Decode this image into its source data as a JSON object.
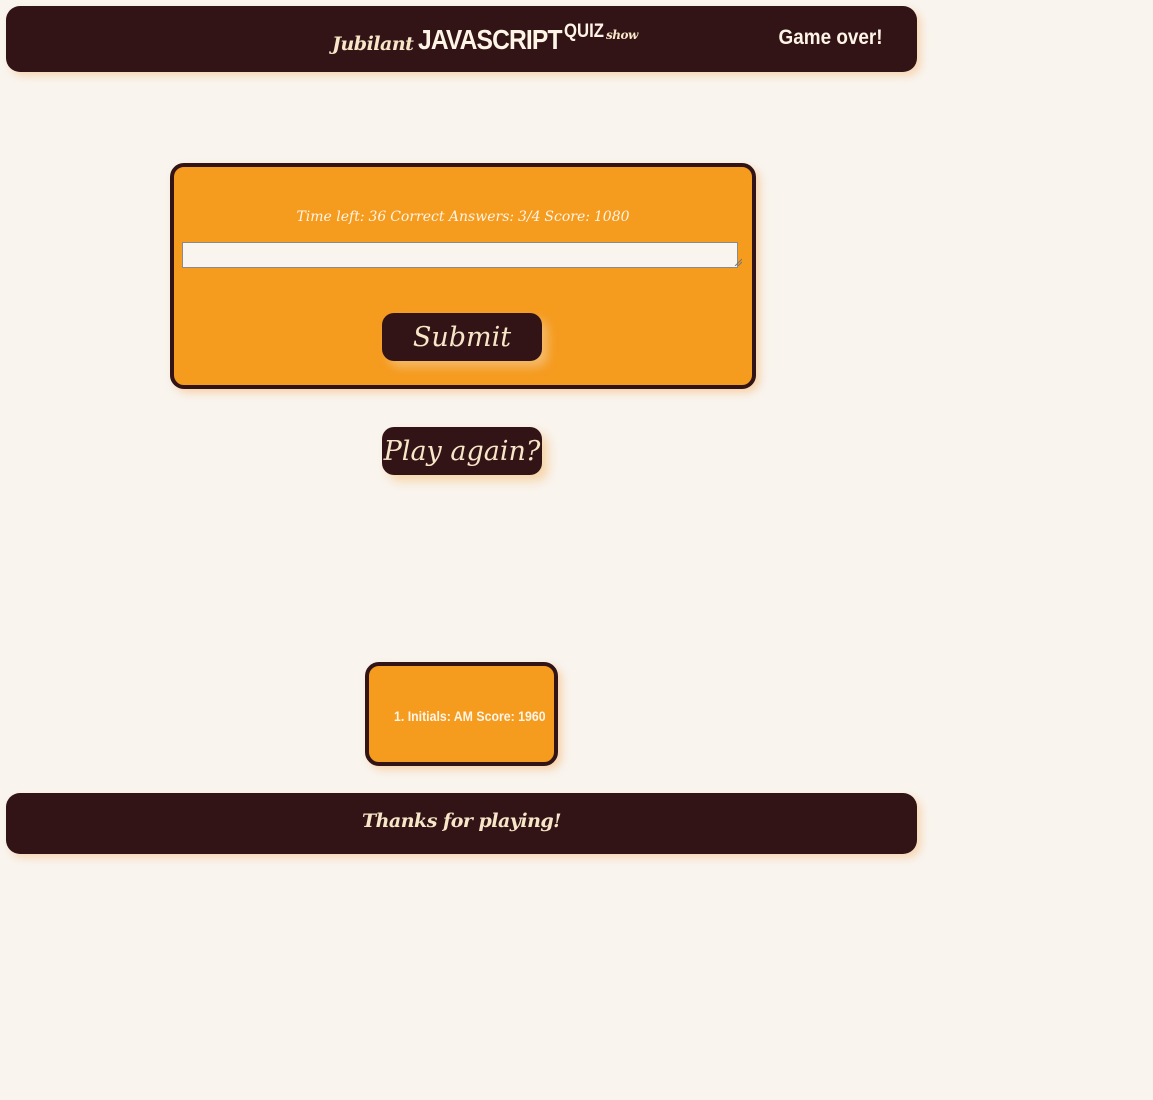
{
  "header": {
    "title_prefix": "Jubilant",
    "title_main": "JAVASCRIPT",
    "title_quiz": "QUIZ",
    "title_suffix": "show",
    "status": "Game over!"
  },
  "quiz": {
    "time_left_label": "Time left:",
    "time_left_value": "36",
    "correct_label": "Correct Answers:",
    "correct_value": "3/4",
    "score_label": "Score:",
    "score_value": "1080",
    "initials_value": "",
    "submit_label": "Submit"
  },
  "play_again_label": "Play again?",
  "high_scores": [
    {
      "text": "1. Initials: AM Score: 1960"
    }
  ],
  "footer": {
    "text": "Thanks for playing!"
  },
  "colors": {
    "dark_brown": "#321416",
    "orange": "#f59b1e",
    "cream": "#f7e6c8",
    "background": "#f9f4ee"
  }
}
